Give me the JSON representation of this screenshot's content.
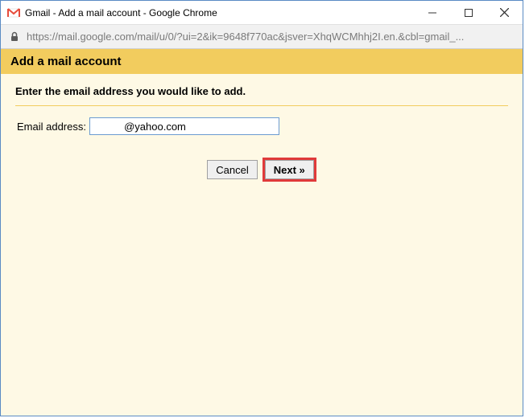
{
  "window": {
    "title": "Gmail - Add a mail account - Google Chrome"
  },
  "addressbar": {
    "url": "https://mail.google.com/mail/u/0/?ui=2&ik=9648f770ac&jsver=XhqWCMhhj2I.en.&cbl=gmail_..."
  },
  "page": {
    "header": "Add a mail account",
    "instruction": "Enter the email address you would like to add.",
    "email_label": "Email address:",
    "email_value": "          @yahoo.com",
    "cancel_label": "Cancel",
    "next_label": "Next »"
  }
}
